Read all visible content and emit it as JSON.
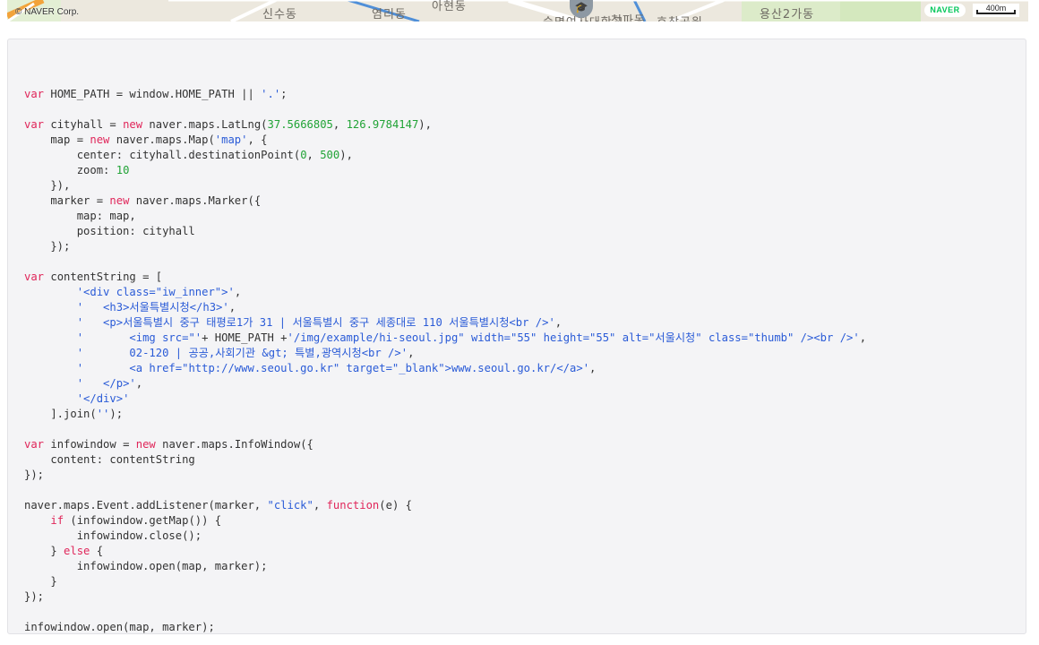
{
  "map": {
    "copyright": "© NAVER Corp.",
    "labels": [
      "신수동",
      "염리동",
      "아현동",
      "숙명여자대학교",
      "청파동",
      "효창공원",
      "용산2가동"
    ],
    "brand": "NAVER",
    "scale": "400m",
    "poi_icon": "graduation-cap-icon"
  },
  "colors": {
    "keyword": "#e0265a",
    "string": "#2a5bd7",
    "number": "#21a336",
    "plain": "#333333",
    "panel_bg": "#f4f4f6",
    "naver_green": "#03c75a"
  },
  "code": {
    "language": "javascript",
    "lines": [
      [],
      [
        {
          "t": "kw",
          "v": "var"
        },
        {
          "t": "pl",
          "v": " HOME_PATH = window.HOME_PATH || "
        },
        {
          "t": "str",
          "v": "'.'"
        },
        {
          "t": "pl",
          "v": ";"
        }
      ],
      [],
      [
        {
          "t": "kw",
          "v": "var"
        },
        {
          "t": "pl",
          "v": " cityhall = "
        },
        {
          "t": "kw",
          "v": "new"
        },
        {
          "t": "pl",
          "v": " naver.maps.LatLng("
        },
        {
          "t": "num",
          "v": "37.5666805"
        },
        {
          "t": "pl",
          "v": ", "
        },
        {
          "t": "num",
          "v": "126.9784147"
        },
        {
          "t": "pl",
          "v": "),"
        }
      ],
      [
        {
          "t": "pl",
          "v": "    map = "
        },
        {
          "t": "kw",
          "v": "new"
        },
        {
          "t": "pl",
          "v": " naver.maps.Map("
        },
        {
          "t": "str",
          "v": "'map'"
        },
        {
          "t": "pl",
          "v": ", {"
        }
      ],
      [
        {
          "t": "pl",
          "v": "        center: cityhall.destinationPoint("
        },
        {
          "t": "num",
          "v": "0"
        },
        {
          "t": "pl",
          "v": ", "
        },
        {
          "t": "num",
          "v": "500"
        },
        {
          "t": "pl",
          "v": "),"
        }
      ],
      [
        {
          "t": "pl",
          "v": "        zoom: "
        },
        {
          "t": "num",
          "v": "10"
        }
      ],
      [
        {
          "t": "pl",
          "v": "    }),"
        }
      ],
      [
        {
          "t": "pl",
          "v": "    marker = "
        },
        {
          "t": "kw",
          "v": "new"
        },
        {
          "t": "pl",
          "v": " naver.maps.Marker({"
        }
      ],
      [
        {
          "t": "pl",
          "v": "        map: map,"
        }
      ],
      [
        {
          "t": "pl",
          "v": "        position: cityhall"
        }
      ],
      [
        {
          "t": "pl",
          "v": "    });"
        }
      ],
      [],
      [
        {
          "t": "kw",
          "v": "var"
        },
        {
          "t": "pl",
          "v": " contentString = ["
        }
      ],
      [
        {
          "t": "pl",
          "v": "        "
        },
        {
          "t": "str",
          "v": "'<div class=\"iw_inner\">'"
        },
        {
          "t": "pl",
          "v": ","
        }
      ],
      [
        {
          "t": "pl",
          "v": "        "
        },
        {
          "t": "str",
          "v": "'   <h3>서울특별시청</h3>'"
        },
        {
          "t": "pl",
          "v": ","
        }
      ],
      [
        {
          "t": "pl",
          "v": "        "
        },
        {
          "t": "str",
          "v": "'   <p>서울특별시 중구 태평로1가 31 | 서울특별시 중구 세종대로 110 서울특별시청<br />'"
        },
        {
          "t": "pl",
          "v": ","
        }
      ],
      [
        {
          "t": "pl",
          "v": "        "
        },
        {
          "t": "str",
          "v": "'       <img src=\"'"
        },
        {
          "t": "pl",
          "v": "+ HOME_PATH +"
        },
        {
          "t": "str",
          "v": "'/img/example/hi-seoul.jpg\" width=\"55\" height=\"55\" alt=\"서울시청\" class=\"thumb\" /><br />'"
        },
        {
          "t": "pl",
          "v": ","
        }
      ],
      [
        {
          "t": "pl",
          "v": "        "
        },
        {
          "t": "str",
          "v": "'       02-120 | 공공,사회기관 &gt; 특별,광역시청<br />'"
        },
        {
          "t": "pl",
          "v": ","
        }
      ],
      [
        {
          "t": "pl",
          "v": "        "
        },
        {
          "t": "str",
          "v": "'       <a href=\"http://www.seoul.go.kr\" target=\"_blank\">www.seoul.go.kr/</a>'"
        },
        {
          "t": "pl",
          "v": ","
        }
      ],
      [
        {
          "t": "pl",
          "v": "        "
        },
        {
          "t": "str",
          "v": "'   </p>'"
        },
        {
          "t": "pl",
          "v": ","
        }
      ],
      [
        {
          "t": "pl",
          "v": "        "
        },
        {
          "t": "str",
          "v": "'</div>'"
        }
      ],
      [
        {
          "t": "pl",
          "v": "    ].join("
        },
        {
          "t": "str",
          "v": "''"
        },
        {
          "t": "pl",
          "v": ");"
        }
      ],
      [],
      [
        {
          "t": "kw",
          "v": "var"
        },
        {
          "t": "pl",
          "v": " infowindow = "
        },
        {
          "t": "kw",
          "v": "new"
        },
        {
          "t": "pl",
          "v": " naver.maps.InfoWindow({"
        }
      ],
      [
        {
          "t": "pl",
          "v": "    content: contentString"
        }
      ],
      [
        {
          "t": "pl",
          "v": "});"
        }
      ],
      [],
      [
        {
          "t": "pl",
          "v": "naver.maps.Event.addListener(marker, "
        },
        {
          "t": "str",
          "v": "\"click\""
        },
        {
          "t": "pl",
          "v": ", "
        },
        {
          "t": "kw",
          "v": "function"
        },
        {
          "t": "pl",
          "v": "(e) {"
        }
      ],
      [
        {
          "t": "pl",
          "v": "    "
        },
        {
          "t": "kw",
          "v": "if"
        },
        {
          "t": "pl",
          "v": " (infowindow.getMap()) {"
        }
      ],
      [
        {
          "t": "pl",
          "v": "        infowindow.close();"
        }
      ],
      [
        {
          "t": "pl",
          "v": "    } "
        },
        {
          "t": "kw",
          "v": "else"
        },
        {
          "t": "pl",
          "v": " {"
        }
      ],
      [
        {
          "t": "pl",
          "v": "        infowindow.open(map, marker);"
        }
      ],
      [
        {
          "t": "pl",
          "v": "    }"
        }
      ],
      [
        {
          "t": "pl",
          "v": "});"
        }
      ],
      [],
      [
        {
          "t": "pl",
          "v": "infowindow.open(map, marker);"
        }
      ]
    ]
  }
}
